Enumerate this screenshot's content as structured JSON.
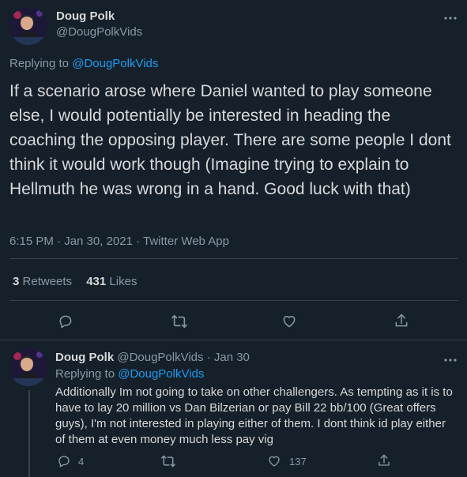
{
  "main_tweet": {
    "author_name": "Doug Polk",
    "author_handle": "@DougPolkVids",
    "replying_prefix": "Replying to",
    "replying_to": "@DougPolkVids",
    "text": "If a scenario arose where Daniel wanted to play someone else, I would potentially be interested in heading the coaching the opposing player. There are some people I dont think it would work though (Imagine trying to explain to Hellmuth he was wrong in a hand. Good luck with that)",
    "meta": "6:15 PM · Jan 30, 2021 · Twitter Web App",
    "retweets_count": "3",
    "retweets_label": "Retweets",
    "likes_count": "431",
    "likes_label": "Likes"
  },
  "reply_tweet": {
    "author_name": "Doug Polk",
    "author_handle": "@DougPolkVids",
    "date": "· Jan 30",
    "replying_prefix": "Replying to",
    "replying_to": "@DougPolkVids",
    "text": "Additionally Im not going to take on other challengers. As tempting as it is to have to lay 20 million vs Dan Bilzerian or pay Bill 22 bb/100 (Great offers guys), I'm not interested in playing either of them. I dont think id play either of them at even money much less pay vig",
    "reply_count": "4",
    "retweet_count": "",
    "like_count": "137"
  },
  "colors": {
    "background": "#15202b",
    "divider": "#38444d",
    "text": "#d9d9d9",
    "muted": "#8899a6",
    "accent": "#1d9bf0"
  },
  "icons": {
    "more": "more-dots-icon",
    "reply": "reply-icon",
    "retweet": "retweet-icon",
    "like": "heart-icon",
    "share": "share-icon"
  }
}
